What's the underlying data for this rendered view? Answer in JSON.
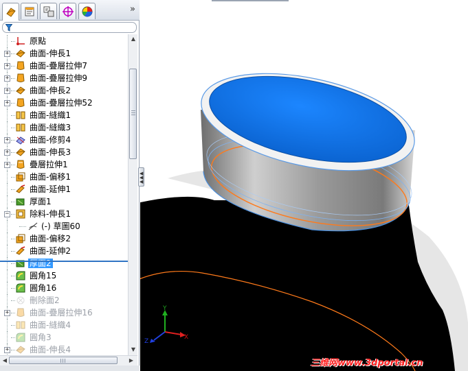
{
  "feature_tree": {
    "items": [
      {
        "label": "原點",
        "icon": "origin-icon",
        "expandable": false,
        "state": "normal"
      },
      {
        "label": "曲面-伸長1",
        "icon": "surface-extrude-icon",
        "expandable": true,
        "state": "normal"
      },
      {
        "label": "曲面-疊層拉伸7",
        "icon": "surface-loft-icon",
        "expandable": true,
        "state": "normal"
      },
      {
        "label": "曲面-疊層拉伸9",
        "icon": "surface-loft-icon",
        "expandable": true,
        "state": "normal"
      },
      {
        "label": "曲面-伸長2",
        "icon": "surface-extrude-icon",
        "expandable": true,
        "state": "normal"
      },
      {
        "label": "曲面-疊層拉伸52",
        "icon": "surface-loft-icon",
        "expandable": true,
        "state": "normal"
      },
      {
        "label": "曲面-縫織1",
        "icon": "surface-knit-icon",
        "expandable": false,
        "state": "normal"
      },
      {
        "label": "曲面-縫織3",
        "icon": "surface-knit-icon",
        "expandable": false,
        "state": "normal"
      },
      {
        "label": "曲面-修剪4",
        "icon": "surface-trim-icon",
        "expandable": true,
        "state": "normal"
      },
      {
        "label": "曲面-伸長3",
        "icon": "surface-extrude-icon",
        "expandable": true,
        "state": "normal"
      },
      {
        "label": "疊層拉伸1",
        "icon": "loft-icon",
        "expandable": true,
        "state": "normal"
      },
      {
        "label": "曲面-偏移1",
        "icon": "surface-offset-icon",
        "expandable": false,
        "state": "normal"
      },
      {
        "label": "曲面-延伸1",
        "icon": "surface-extend-icon",
        "expandable": false,
        "state": "normal"
      },
      {
        "label": "厚面1",
        "icon": "thicken-icon",
        "expandable": false,
        "state": "normal"
      },
      {
        "label": "除料-伸長1",
        "icon": "extruded-cut-icon",
        "expandable": true,
        "expanded": true,
        "state": "normal"
      },
      {
        "label": "(-) 草圖60",
        "icon": "sketch-icon",
        "expandable": false,
        "state": "child"
      },
      {
        "label": "曲面-偏移2",
        "icon": "surface-offset-icon",
        "expandable": false,
        "state": "normal"
      },
      {
        "label": "曲面-延伸2",
        "icon": "surface-extend-icon",
        "expandable": false,
        "state": "normal"
      },
      {
        "label": "厚面2",
        "icon": "thicken-icon",
        "expandable": false,
        "state": "selected"
      },
      {
        "label": "圓角15",
        "icon": "fillet-icon",
        "expandable": false,
        "state": "normal"
      },
      {
        "label": "圓角16",
        "icon": "fillet-icon",
        "expandable": false,
        "state": "normal"
      },
      {
        "label": "刪除面2",
        "icon": "delete-face-icon",
        "expandable": false,
        "state": "suppressed"
      },
      {
        "label": "曲面-疊層拉伸16",
        "icon": "surface-loft-icon",
        "expandable": true,
        "state": "suppressed"
      },
      {
        "label": "曲面-縫織4",
        "icon": "surface-knit-icon",
        "expandable": false,
        "state": "suppressed"
      },
      {
        "label": "圓角3",
        "icon": "fillet-icon",
        "expandable": false,
        "state": "suppressed"
      },
      {
        "label": "曲面-伸長4",
        "icon": "surface-extrude-icon",
        "expandable": true,
        "state": "suppressed"
      }
    ]
  },
  "tabs": [
    {
      "icon": "feature-manager-icon",
      "active": true
    },
    {
      "icon": "property-manager-icon",
      "active": false
    },
    {
      "icon": "configuration-manager-icon",
      "active": false
    },
    {
      "icon": "dimxpert-icon",
      "active": false
    },
    {
      "icon": "display-manager-icon",
      "active": false
    }
  ],
  "triad": {
    "x_label": "X",
    "y_label": "Y",
    "z_label": "Z"
  },
  "watermark": "三维网www.3dportal.cn",
  "colors": {
    "selection": "#3399ff",
    "face_blue": "#0a6ee0",
    "edge_orange": "#ff7a1a",
    "rollback_bar": "#2f74c4",
    "watermark": "#ff2020"
  }
}
